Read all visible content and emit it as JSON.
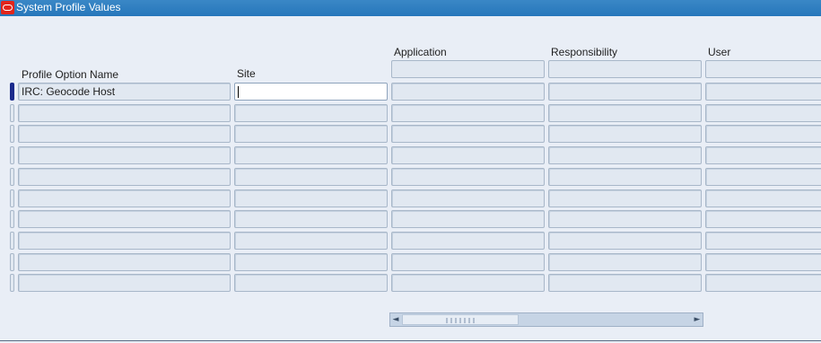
{
  "window": {
    "title": "System Profile Values"
  },
  "headers": {
    "profile_option_name": "Profile Option Name",
    "site": "Site",
    "application": "Application",
    "responsibility": "Responsibility",
    "user": "User"
  },
  "rows": [
    {
      "profile_option_name": "IRC: Geocode Host",
      "site": "",
      "application": "",
      "responsibility": "",
      "user": ""
    },
    {
      "profile_option_name": "",
      "site": "",
      "application": "",
      "responsibility": "",
      "user": ""
    },
    {
      "profile_option_name": "",
      "site": "",
      "application": "",
      "responsibility": "",
      "user": ""
    },
    {
      "profile_option_name": "",
      "site": "",
      "application": "",
      "responsibility": "",
      "user": ""
    },
    {
      "profile_option_name": "",
      "site": "",
      "application": "",
      "responsibility": "",
      "user": ""
    },
    {
      "profile_option_name": "",
      "site": "",
      "application": "",
      "responsibility": "",
      "user": ""
    },
    {
      "profile_option_name": "",
      "site": "",
      "application": "",
      "responsibility": "",
      "user": ""
    },
    {
      "profile_option_name": "",
      "site": "",
      "application": "",
      "responsibility": "",
      "user": ""
    },
    {
      "profile_option_name": "",
      "site": "",
      "application": "",
      "responsibility": "",
      "user": ""
    },
    {
      "profile_option_name": "",
      "site": "",
      "application": "",
      "responsibility": "",
      "user": ""
    }
  ],
  "scrollbar": {
    "left_arrow": "◄",
    "right_arrow": "►"
  }
}
